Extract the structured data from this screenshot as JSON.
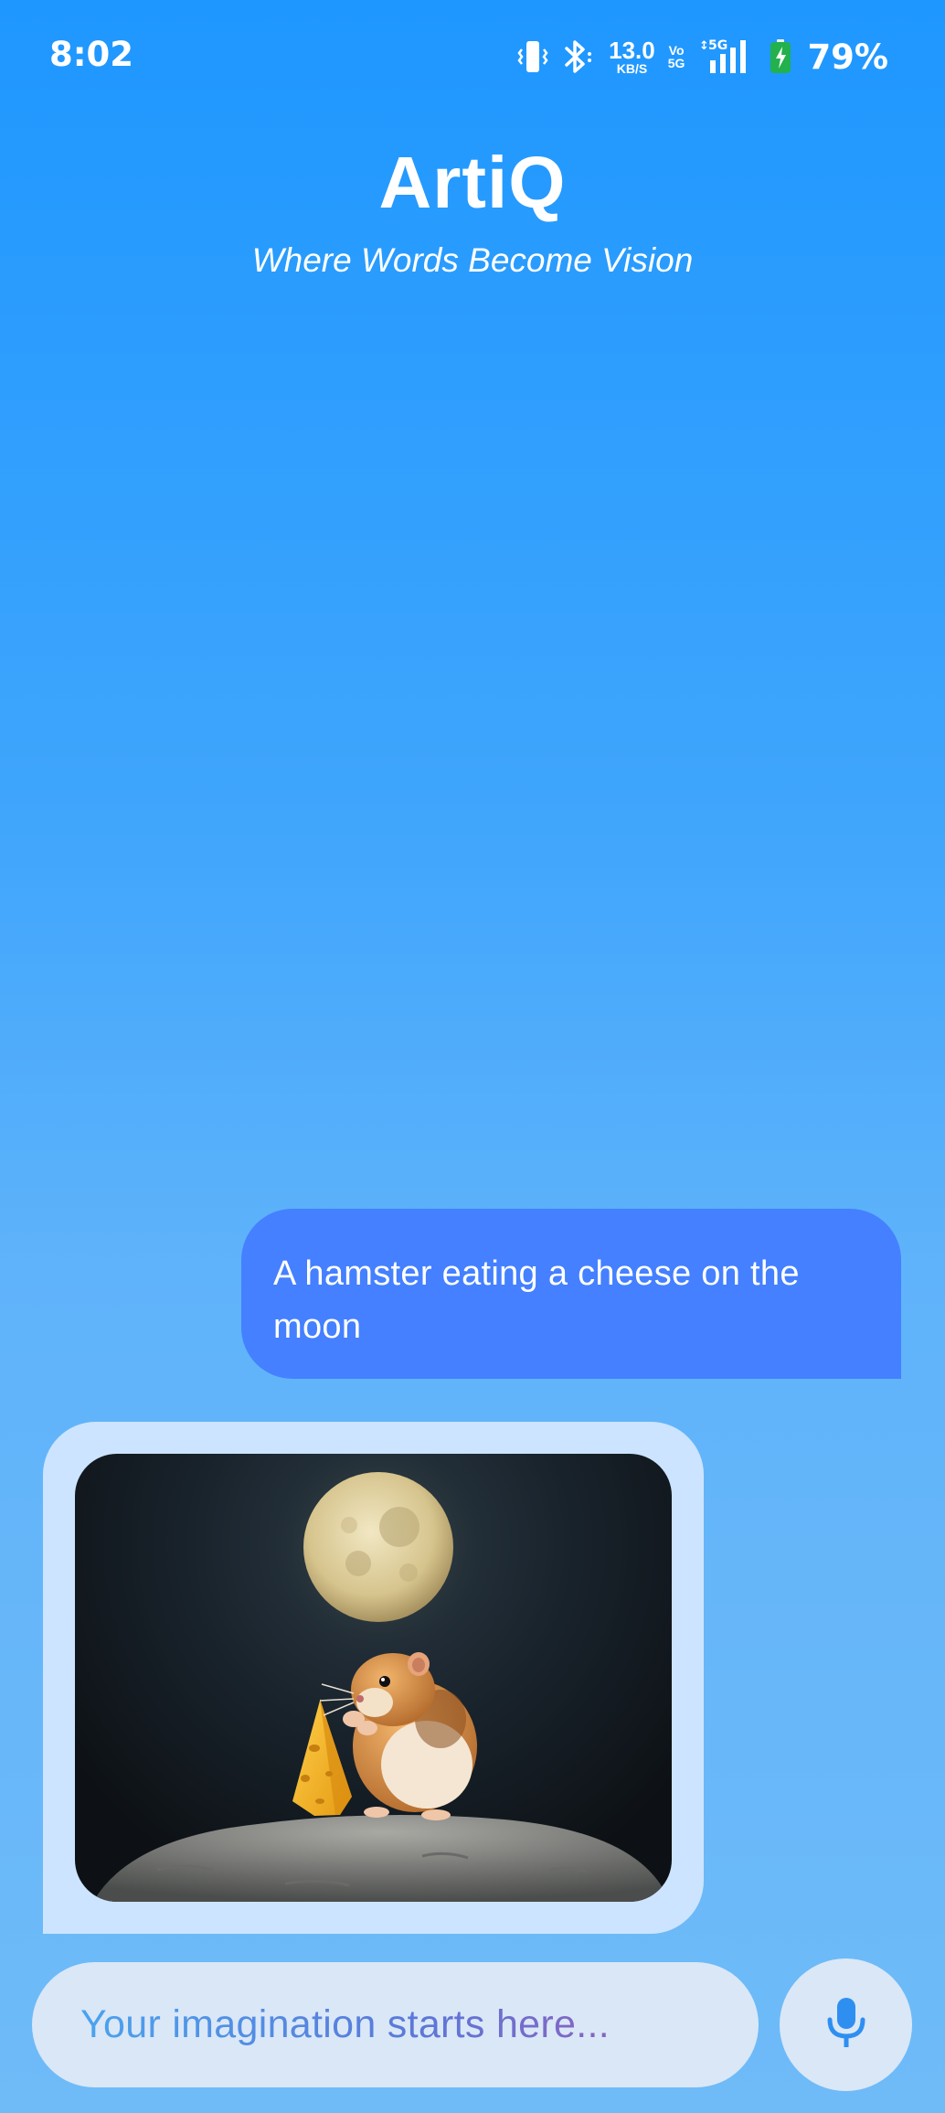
{
  "status_bar": {
    "time": "8:02",
    "net_speed_value": "13.0",
    "net_speed_unit": "KB/S",
    "volte_top": "Vo",
    "volte_bottom": "5G",
    "signal_type": "5G",
    "battery_percent": "79%",
    "icons": [
      "vibrate-icon",
      "bluetooth-icon",
      "signal-icon",
      "battery-charging-icon"
    ]
  },
  "header": {
    "title": "ArtiQ",
    "tagline": "Where Words Become Vision"
  },
  "chat": {
    "messages": [
      {
        "sender": "user",
        "text": "A hamster eating a cheese on the moon"
      },
      {
        "sender": "bot",
        "type": "image",
        "depicts": "hamster holding a wedge of cheese on a lunar rock under a full moon"
      }
    ]
  },
  "input": {
    "placeholder": "Your imagination starts here...",
    "mic_icon": "microphone-icon"
  },
  "colors": {
    "background_top": "#1e97ff",
    "background_bottom": "#6fbbf8",
    "user_bubble": "#4480ff",
    "bot_bubble": "#cce4ff",
    "input_bg": "#dae7f7",
    "mic_icon": "#2e8ff0"
  }
}
